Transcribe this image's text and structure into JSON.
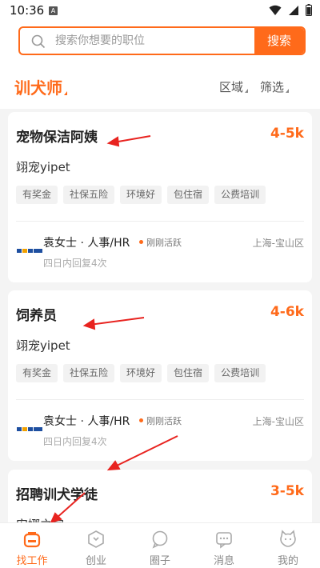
{
  "status_bar": {
    "time": "10:36",
    "notification_icon": "A"
  },
  "search": {
    "placeholder": "搜索你想要的职位",
    "button_label": "搜索"
  },
  "filter_bar": {
    "category": "训犬师",
    "region_label": "区域",
    "filter_label": "筛选"
  },
  "jobs": [
    {
      "title": "宠物保洁阿姨",
      "salary": "4-5k",
      "company": "翊宠yipet",
      "tags": [
        "有奖金",
        "社保五险",
        "环境好",
        "包住宿",
        "公费培训"
      ],
      "recruiter": "袁女士 · 人事/HR",
      "active_status": "刚刚活跃",
      "location": "上海-宝山区",
      "reply_note": "四日内回复4次"
    },
    {
      "title": "饲养员",
      "salary": "4-6k",
      "company": "翊宠yipet",
      "tags": [
        "有奖金",
        "社保五险",
        "环境好",
        "包住宿",
        "公费培训"
      ],
      "recruiter": "袁女士 · 人事/HR",
      "active_status": "刚刚活跃",
      "location": "上海-宝山区",
      "reply_note": "四日内回复4次"
    },
    {
      "title": "招聘训犬学徒",
      "salary": "3-5k",
      "company": "安娜之家"
    }
  ],
  "tab_bar": {
    "items": [
      {
        "label": "找工作",
        "icon": "briefcase-icon",
        "active": true
      },
      {
        "label": "创业",
        "icon": "startup-icon",
        "active": false
      },
      {
        "label": "圈子",
        "icon": "chat-bubble-icon",
        "active": false
      },
      {
        "label": "消息",
        "icon": "message-icon",
        "active": false
      },
      {
        "label": "我的",
        "icon": "cat-face-icon",
        "active": false
      }
    ]
  },
  "colors": {
    "accent": "#ff6a1a",
    "annotation_arrow": "#e8231f"
  }
}
